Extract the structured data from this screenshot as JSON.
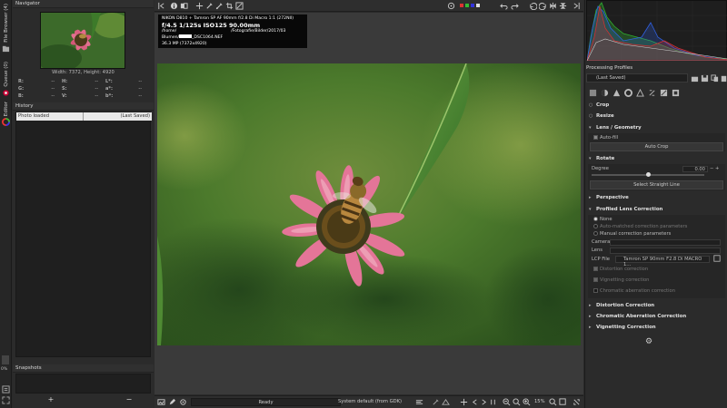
{
  "app": {
    "vertical_tabs": [
      "File Browser (4)",
      "Queue (0)",
      "Editor"
    ]
  },
  "navigator": {
    "title": "Navigator",
    "dimensions": "Width: 7372, Height: 4920",
    "readouts": [
      [
        "R:",
        "--",
        "H:",
        "--",
        "L*:",
        "--"
      ],
      [
        "G:",
        "--",
        "S:",
        "--",
        "a*:",
        "--"
      ],
      [
        "B:",
        "--",
        "V:",
        "--",
        "b*:",
        "--"
      ]
    ]
  },
  "history": {
    "title": "History",
    "rows": [
      {
        "label": "Photo loaded",
        "state": "(Last Saved)"
      }
    ]
  },
  "snapshots": {
    "title": "Snapshots",
    "add": "+",
    "remove": "−"
  },
  "exif": {
    "camera": "NIKON D810 + Tamron SP AF 90mm f/2.8 Di Macro 1:1 (272NII)",
    "exposure": "f/4.5  1/125s  ISO125  90.00mm",
    "path_start": "/home/",
    "path_end": "/Fotografie/Bilder/2017/03 Blumen/",
    "file": "_DSC1064.NEF",
    "size": "36.3 MP (7372x4920)"
  },
  "statusbar": {
    "status": "Ready",
    "output_profile": "System default (from GDK)",
    "zoom": "15%",
    "left_percent": "0%"
  },
  "right": {
    "profiles_title": "Processing Profiles",
    "profile_value": "(Last Saved)",
    "sections": {
      "crop": "Crop",
      "resize": "Resize",
      "lens_geometry": "Lens / Geometry",
      "auto_fill": "Auto-fill",
      "auto_crop": "Auto Crop",
      "rotate": "Rotate",
      "degree_label": "Degree",
      "degree_value": "0.00",
      "select_straight_line": "Select Straight Line",
      "perspective": "Perspective",
      "profiled_lens": "Profiled Lens Correction",
      "opt_none": "None",
      "opt_auto": "Auto-matched correction parameters",
      "opt_manual": "Manual correction parameters",
      "camera_label": "Camera",
      "lens_label": "Lens",
      "lcp_label": "LCP File",
      "lcp_value": "Tamron SP 90mm F2.8 Di MACRO 1...",
      "distortion_chk": "Distortion correction",
      "vignetting_chk": "Vignetting correction",
      "ca_chk": "Chromatic aberration correction",
      "distortion_sec": "Distortion Correction",
      "ca_sec": "Chromatic Aberration Correction",
      "vignetting_sec": "Vignetting Correction"
    }
  },
  "colors": {
    "panel_bg": "#2b2b2b",
    "histogram_red": "#d03030",
    "histogram_green": "#30b030",
    "histogram_blue": "#3060e0"
  }
}
